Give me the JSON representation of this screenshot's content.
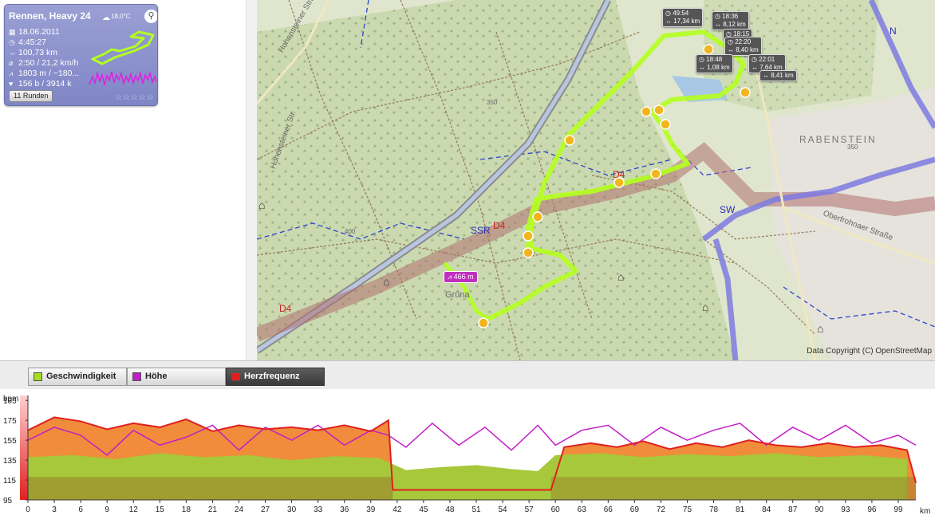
{
  "activity": {
    "title": "Rennen, Heavy 24",
    "temperature": "18,0°C",
    "date": "18.06.2011",
    "duration": "4:45:27",
    "distance": "100,73 km",
    "pace_speed": "2:50 / 21,2 km/h",
    "elevation": "1803 m / −180...",
    "heart_beats": "156 b / 3914 k",
    "laps_button": "11 Runden",
    "rating_stars": "☆☆☆☆☆",
    "icons": {
      "weather": "cloud-icon",
      "sport": "bike-icon",
      "date": "calendar-icon",
      "duration": "clock-icon",
      "distance": "distance-icon",
      "speed": "speed-icon",
      "elevation": "elevation-icon",
      "heart": "heart-icon"
    }
  },
  "map": {
    "copyright": "Data Copyright (C) OpenStreetMap",
    "town_name": "RABENSTEIN",
    "place_name": "Grüna",
    "street_labels": [
      "Hohensteiner Straße",
      "Oberfrohnaer Straße",
      "Hohensteiner Str."
    ],
    "road_labels": [
      "SSR",
      "D4",
      "SW",
      "N"
    ],
    "elevation_marker": "466 m",
    "contour_labels": [
      "350",
      "350",
      "400",
      "350"
    ],
    "lap_markers": [
      {
        "time": "49:54",
        "distance": "17,34 km"
      },
      {
        "time": "18:36",
        "distance": "8,12 km"
      },
      {
        "time": "18:15",
        "distance": ""
      },
      {
        "time": "22:20",
        "distance": "8,40 km"
      },
      {
        "time": "18:48",
        "distance": "1,08 km"
      },
      {
        "time": "22:01",
        "distance": "7,64 km"
      },
      {
        "time": "",
        "distance": "8,41 km"
      }
    ]
  },
  "legend": {
    "speed": {
      "label": "Geschwindigkeit",
      "color": "#a6dc1e"
    },
    "elevation": {
      "label": "Höhe",
      "color": "#c21ec8"
    },
    "heartrate": {
      "label": "Herzfrequenz",
      "color": "#e02020",
      "active": true
    }
  },
  "chart_data": {
    "type": "area",
    "y_unit": "bpm",
    "x_unit": "km",
    "y_ticks": [
      95,
      115,
      135,
      155,
      175,
      195
    ],
    "ylim": [
      95,
      200
    ],
    "x_ticks": [
      0,
      3,
      6,
      9,
      12,
      15,
      18,
      21,
      24,
      27,
      30,
      33,
      36,
      39,
      42,
      45,
      48,
      51,
      54,
      57,
      60,
      63,
      66,
      69,
      72,
      75,
      78,
      81,
      84,
      87,
      90,
      93,
      96,
      99
    ],
    "xlim": [
      0,
      101
    ],
    "gap_range_km": [
      41.5,
      59.5
    ],
    "series": [
      {
        "name": "Herzfrequenz",
        "x": [
          0,
          3,
          6,
          9,
          12,
          15,
          18,
          21,
          24,
          27,
          30,
          33,
          36,
          39,
          41,
          41.5,
          59.5,
          61,
          64,
          67,
          70,
          73,
          76,
          79,
          82,
          85,
          88,
          91,
          94,
          97,
          100,
          101
        ],
        "values": [
          165,
          178,
          174,
          166,
          172,
          168,
          176,
          164,
          170,
          166,
          168,
          165,
          170,
          164,
          175,
          105,
          105,
          148,
          152,
          148,
          154,
          146,
          152,
          148,
          155,
          150,
          148,
          152,
          148,
          150,
          145,
          112
        ]
      },
      {
        "name": "Höhe",
        "x": [
          0,
          3,
          6,
          9,
          12,
          15,
          18,
          21,
          24,
          27,
          30,
          33,
          36,
          39,
          41,
          43,
          46,
          49,
          52,
          55,
          58,
          60,
          63,
          66,
          69,
          72,
          75,
          78,
          81,
          84,
          87,
          90,
          93,
          96,
          99,
          101
        ],
        "values": [
          155,
          168,
          160,
          140,
          165,
          150,
          158,
          170,
          145,
          168,
          155,
          170,
          150,
          165,
          160,
          148,
          172,
          150,
          168,
          145,
          170,
          150,
          165,
          170,
          150,
          168,
          155,
          165,
          172,
          150,
          168,
          155,
          170,
          152,
          160,
          150
        ]
      },
      {
        "name": "Geschwindigkeit",
        "x": [
          0,
          5,
          10,
          15,
          20,
          25,
          30,
          35,
          40,
          43,
          47,
          51,
          55,
          58,
          60,
          65,
          70,
          75,
          80,
          85,
          90,
          95,
          100
        ],
        "values": [
          138,
          140,
          136,
          142,
          138,
          140,
          135,
          139,
          137,
          125,
          128,
          130,
          126,
          124,
          140,
          142,
          138,
          141,
          139,
          142,
          138,
          140,
          136
        ]
      }
    ]
  }
}
